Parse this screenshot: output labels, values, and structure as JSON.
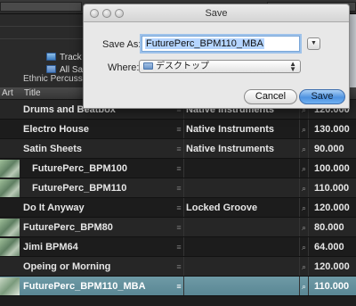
{
  "dialog": {
    "title": "Save",
    "save_as_label": "Save As:",
    "save_as_value": "FuturePerc_BPM110_MBA",
    "where_label": "Where:",
    "where_value": "デスクトップ",
    "expand_glyph": "▼",
    "cancel_label": "Cancel",
    "save_label": "Save"
  },
  "browser": {
    "tree": [
      {
        "label": "Track"
      },
      {
        "label": "All Sa"
      }
    ],
    "ethnic_label": "Ethnic Percuss",
    "columns": {
      "art": "Art",
      "title": "Title"
    },
    "rows": [
      {
        "title": "Drums and Beatbox",
        "label": "Native Instruments",
        "bpm": "120.000",
        "art": false,
        "indent": false,
        "selected": false
      },
      {
        "title": "Electro House",
        "label": "Native Instruments",
        "bpm": "130.000",
        "art": false,
        "indent": false,
        "selected": false
      },
      {
        "title": "Satin Sheets",
        "label": "Native Instruments",
        "bpm": "90.000",
        "art": false,
        "indent": false,
        "selected": false
      },
      {
        "title": "FuturePerc_BPM100",
        "label": "",
        "bpm": "100.000",
        "art": true,
        "indent": true,
        "selected": false
      },
      {
        "title": "FuturePerc_BPM110",
        "label": "",
        "bpm": "110.000",
        "art": true,
        "indent": true,
        "selected": false
      },
      {
        "title": "Do It Anyway",
        "label": "Locked Groove",
        "bpm": "120.000",
        "art": false,
        "indent": false,
        "selected": false
      },
      {
        "title": "FuturePerc_BPM80",
        "label": "",
        "bpm": "80.000",
        "art": true,
        "indent": false,
        "selected": false
      },
      {
        "title": "Jimi BPM64",
        "label": "",
        "bpm": "64.000",
        "art": true,
        "indent": false,
        "selected": false
      },
      {
        "title": "Opeing or Morning",
        "label": "",
        "bpm": "120.000",
        "art": false,
        "indent": false,
        "selected": false
      },
      {
        "title": "FuturePerc_BPM110_MBA",
        "label": "",
        "bpm": "110.000",
        "art": true,
        "indent": false,
        "selected": true
      }
    ]
  }
}
